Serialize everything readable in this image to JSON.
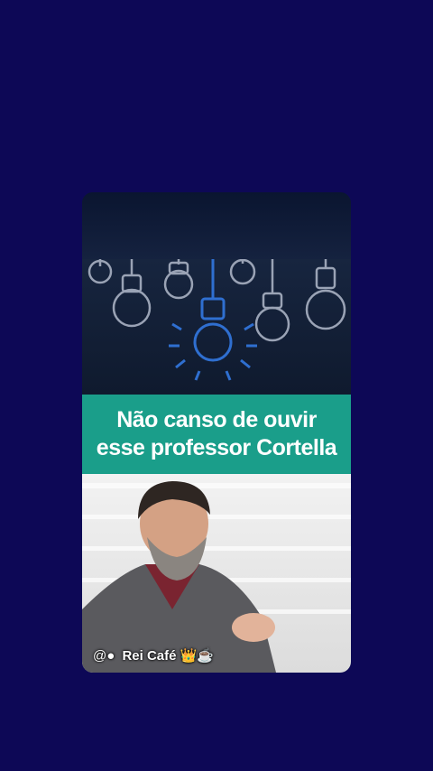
{
  "caption": {
    "line1": "Não canso de ouvir",
    "line2": "esse professor Cortella"
  },
  "watermark": {
    "at": "@●",
    "name": "Rei Café",
    "emoji": "👑☕"
  },
  "icons": [
    "lightbulb-icon",
    "crown-icon",
    "coffee-icon"
  ],
  "colors": {
    "background": "#0d0856",
    "caption_bg": "#1a9e8a",
    "bulb_stroke": "#9aa3b5",
    "highlight_bulb": "#2f6fd0"
  }
}
